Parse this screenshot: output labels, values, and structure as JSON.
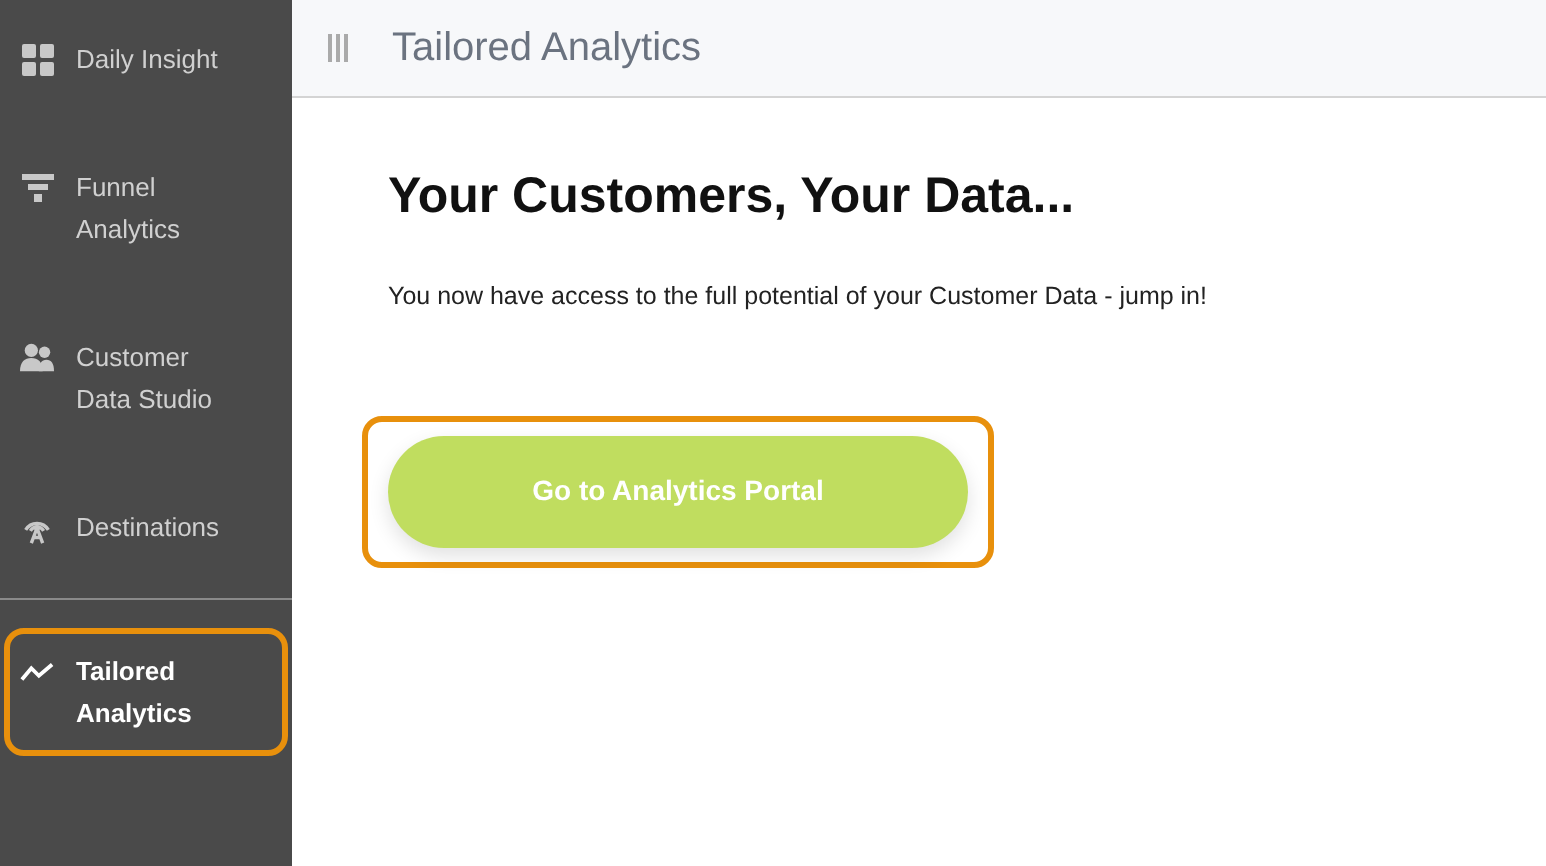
{
  "sidebar": {
    "sections": [
      [
        {
          "label": "Daily Insight",
          "selected": false,
          "highlighted": false
        },
        {
          "label": "Funnel Analytics",
          "selected": false,
          "highlighted": false
        },
        {
          "label": "Customer Data Studio",
          "selected": false,
          "highlighted": false
        },
        {
          "label": "Destinations",
          "selected": false,
          "highlighted": false
        }
      ],
      [
        {
          "label": "Tailored Analytics",
          "selected": true,
          "highlighted": true
        }
      ]
    ]
  },
  "header": {
    "title": "Tailored Analytics"
  },
  "main": {
    "heading": "Your Customers, Your Data...",
    "text": "You now have access to the full potential of your Customer Data - jump in!",
    "button": {
      "label": "Go to Analytics Portal",
      "highlighted": true
    }
  }
}
